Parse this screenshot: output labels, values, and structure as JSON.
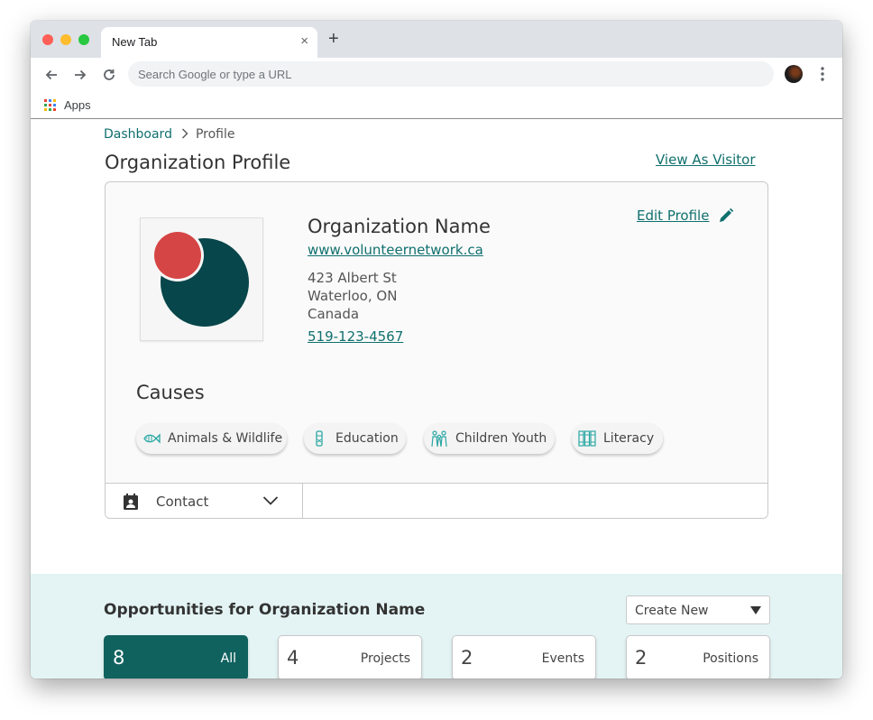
{
  "browser": {
    "tab_title": "New Tab",
    "tab_close": "×",
    "new_tab": "+",
    "omnibox_placeholder": "Search Google or type a URL",
    "bookmarks": {
      "apps_label": "Apps"
    }
  },
  "breadcrumb": {
    "parent": "Dashboard",
    "current": "Profile"
  },
  "page": {
    "title": "Organization Profile",
    "view_as_visitor": "View As Visitor"
  },
  "profile": {
    "name": "Organization Name",
    "url": "www.volunteernetwork.ca",
    "address_line1": "423 Albert St",
    "address_line2": "Waterloo, ON",
    "address_line3": "Canada",
    "phone": "519-123-4567",
    "edit_label": "Edit Profile",
    "logo_colors": {
      "big_circle": "#07464a",
      "small_circle": "#d64545"
    }
  },
  "causes": {
    "title": "Causes",
    "items": [
      {
        "label": "Animals & Wildlife",
        "icon": "fish-icon"
      },
      {
        "label": "Education",
        "icon": "education-icon"
      },
      {
        "label": "Children Youth",
        "icon": "family-icon"
      },
      {
        "label": "Literacy",
        "icon": "books-icon"
      }
    ]
  },
  "contact": {
    "label": "Contact"
  },
  "opportunities": {
    "title": "Opportunities for Organization Name",
    "create_new": "Create New",
    "stats": [
      {
        "count": "8",
        "label": "All",
        "active": true
      },
      {
        "count": "4",
        "label": "Projects",
        "active": false
      },
      {
        "count": "2",
        "label": "Events",
        "active": false
      },
      {
        "count": "2",
        "label": "Positions",
        "active": false
      }
    ]
  },
  "colors": {
    "accent": "#10706e",
    "active_stat": "#10625f",
    "band": "#e4f4f4"
  }
}
